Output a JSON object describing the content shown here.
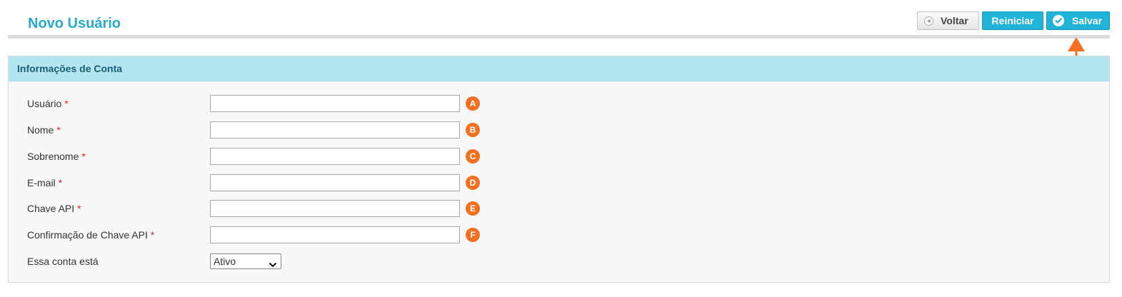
{
  "header": {
    "title": "Novo Usuário"
  },
  "toolbar": {
    "back_label": "Voltar",
    "reset_label": "Reiniciar",
    "save_label": "Salvar"
  },
  "section": {
    "title": "Informações de Conta",
    "fields": [
      {
        "label": "Usuário",
        "required": "*",
        "value": "",
        "badge": "A"
      },
      {
        "label": "Nome",
        "required": "*",
        "value": "",
        "badge": "B"
      },
      {
        "label": "Sobrenome",
        "required": "*",
        "value": "",
        "badge": "C"
      },
      {
        "label": "E-mail",
        "required": "*",
        "value": "",
        "badge": "D"
      },
      {
        "label": "Chave API",
        "required": "*",
        "value": "",
        "badge": "E"
      },
      {
        "label": "Confirmação de Chave API",
        "required": "*",
        "value": "",
        "badge": "F"
      }
    ],
    "status": {
      "label": "Essa conta está",
      "selected": "Ativo"
    }
  },
  "colors": {
    "title": "#2aa9cf",
    "accent_button": "#1fb4d8",
    "section_header_bg": "#b3e6f1",
    "badge": "#f37021",
    "annotation_arrow": "#f37021",
    "required_marker": "#d9232b"
  },
  "icons": {
    "back": "circle-left-arrow-icon",
    "save": "circle-check-icon",
    "select": "chevron-down-icon",
    "annotation": "orange-up-arrow"
  }
}
